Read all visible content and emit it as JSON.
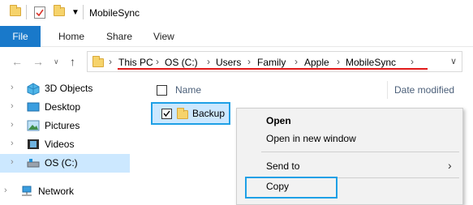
{
  "window": {
    "title": "MobileSync"
  },
  "ribbon": {
    "tabs": [
      "File",
      "Home",
      "Share",
      "View"
    ]
  },
  "address": {
    "crumbs": [
      "This PC",
      "OS (C:)",
      "Users",
      "Family",
      "Apple",
      "MobileSync"
    ]
  },
  "sidebar": {
    "items": [
      {
        "label": "3D Objects",
        "icon": "3d-objects-icon"
      },
      {
        "label": "Desktop",
        "icon": "desktop-icon"
      },
      {
        "label": "Pictures",
        "icon": "pictures-icon"
      },
      {
        "label": "Videos",
        "icon": "videos-icon"
      },
      {
        "label": "OS (C:)",
        "icon": "drive-icon",
        "selected": true
      },
      {
        "label": "Network",
        "icon": "network-icon"
      }
    ]
  },
  "columns": {
    "name": "Name",
    "date_modified": "Date modified"
  },
  "files": [
    {
      "name": "Backup",
      "checked": true
    }
  ],
  "context_menu": {
    "items": [
      "Open",
      "Open in new window",
      "Send to",
      "Copy"
    ]
  },
  "colors": {
    "accent": "#1979ca",
    "highlight": "#1ea0e6",
    "underline": "#e21a1a",
    "selection": "#cce8ff"
  }
}
